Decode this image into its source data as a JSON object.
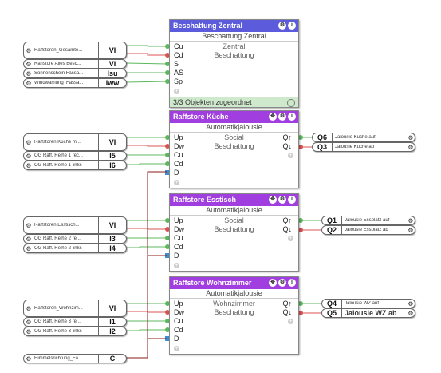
{
  "central": {
    "title": "Beschattung Zentral",
    "subtitle": "Beschattung Zentral",
    "center1": "Zentral",
    "center2": "Beschattung",
    "inputs": [
      "Cu",
      "Cd",
      "S",
      "AS",
      "Sp"
    ],
    "status": "3/3 Objekten zugeordnet",
    "color": "#5b5bdc"
  },
  "kueche": {
    "title": "Raffstore Küche",
    "subtitle": "Automatikjalousie",
    "center1": "Social",
    "center2": "Beschattung",
    "inputs": [
      "Up",
      "Dw",
      "Cu",
      "Cd",
      "D"
    ],
    "outputs": [
      "Q↑",
      "Q↓"
    ],
    "color": "#a03ee0"
  },
  "esstisch": {
    "title": "Raffstore Esstisch",
    "subtitle": "Automatikjalousie",
    "center1": "Social",
    "center2": "Beschattung",
    "inputs": [
      "Up",
      "Dw",
      "Cu",
      "Cd",
      "D"
    ],
    "outputs": [
      "Q↑",
      "Q↓"
    ],
    "color": "#a03ee0"
  },
  "wohnzimmer": {
    "title": "Raffstore Wohnzimmer",
    "subtitle": "Automatikjalousie",
    "center1": "Wohnzimmer",
    "center2": "Beschattung",
    "inputs": [
      "Up",
      "Dw",
      "Cu",
      "Cd",
      "D"
    ],
    "outputs": [
      "Q↑",
      "Q↓"
    ],
    "color": "#a03ee0"
  },
  "left_inputs": [
    {
      "name": "Raffstoren_Gesamte...",
      "tag": "VI"
    },
    {
      "name": "Raffstore Alles Besc...",
      "tag": "VI"
    },
    {
      "name": "Sonnenschein Fassa...",
      "tag": "Isu"
    },
    {
      "name": "Windwarnung_Fassa...",
      "tag": "Iww"
    },
    {
      "name": "Raffstoren Küche m...",
      "tag": "VI"
    },
    {
      "name": "OG Raff. Reihe 1 rec...",
      "tag": "I5"
    },
    {
      "name": "OG Raff. Reihe 1 links",
      "tag": "I6"
    },
    {
      "name": "Raffstoren Esstisch...",
      "tag": "VI"
    },
    {
      "name": "OG Raff. Reihe 2 re...",
      "tag": "I3"
    },
    {
      "name": "OG Raff. Reihe 2 links",
      "tag": "I4"
    },
    {
      "name": "Raffstoren_Wohnzim...",
      "tag": "VI"
    },
    {
      "name": "OG Raff. Reihe 3 re...",
      "tag": "I1"
    },
    {
      "name": "OG Raff. Reihe 3 links",
      "tag": "I2"
    },
    {
      "name": "Himmelsrichtung_Fa...",
      "tag": "C"
    }
  ],
  "outputs": [
    {
      "tag": "Q6",
      "name": "Jalousie Küche auf"
    },
    {
      "tag": "Q3",
      "name": "Jalousie Küche ab"
    },
    {
      "tag": "Q1",
      "name": "Jalousie Essplatz auf"
    },
    {
      "tag": "Q2",
      "name": "Jalousie Essplatz ab"
    },
    {
      "tag": "Q4",
      "name": "Jalousie WZ auf"
    },
    {
      "tag": "Q5",
      "name": "Jalousie WZ ab"
    }
  ],
  "colors": {
    "wire_green": "#5cb85c",
    "wire_red": "#d9534f",
    "wire_dark": "#8b1a1a",
    "port_blue": "#3a8fd6"
  }
}
